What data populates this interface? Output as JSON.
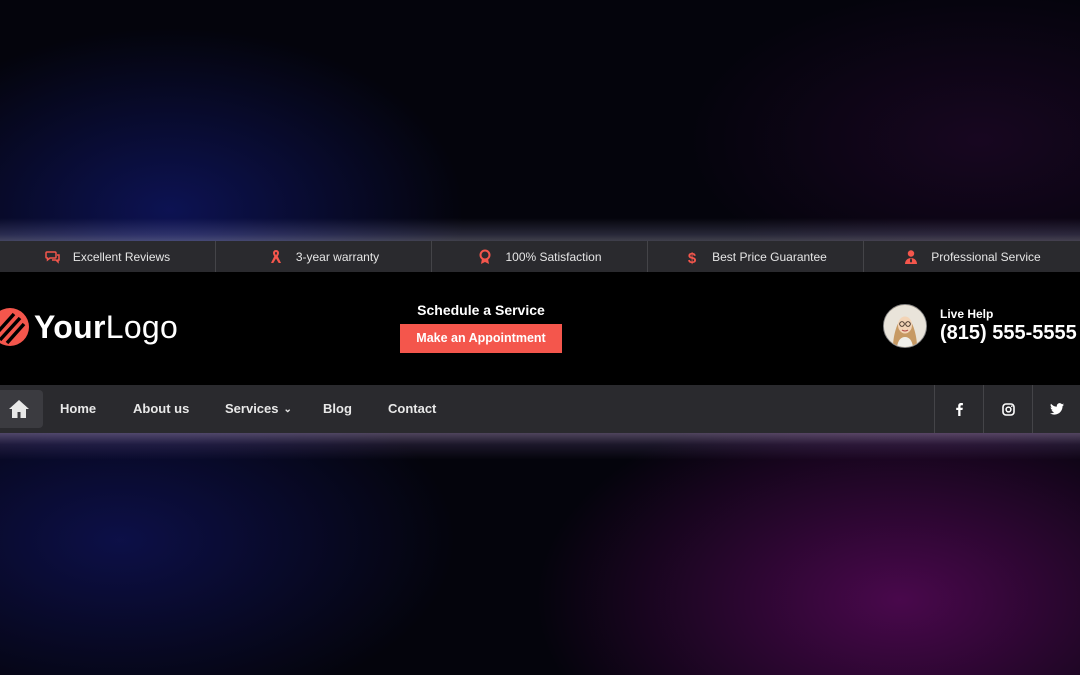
{
  "features": [
    {
      "label": "Excellent Reviews",
      "icon": "chat-bubbles-icon"
    },
    {
      "label": "3-year warranty",
      "icon": "ribbon-icon"
    },
    {
      "label": "100% Satisfaction",
      "icon": "award-badge-icon"
    },
    {
      "label": "Best Price Guarantee",
      "icon": "dollar-icon"
    },
    {
      "label": "Professional Service",
      "icon": "user-tie-icon"
    }
  ],
  "logo": {
    "bold": "Your",
    "regular": "Logo"
  },
  "schedule": {
    "title": "Schedule a Service",
    "button_label": "Make an Appointment"
  },
  "help": {
    "label": "Live Help",
    "phone": "(815) 555-5555"
  },
  "nav": {
    "home_icon": "home-icon",
    "items": [
      {
        "label": "Home"
      },
      {
        "label": "About us"
      },
      {
        "label": "Services",
        "has_dropdown": true
      },
      {
        "label": "Blog"
      },
      {
        "label": "Contact"
      }
    ]
  },
  "socials": [
    "facebook-icon",
    "instagram-icon",
    "twitter-icon"
  ],
  "colors": {
    "accent": "#f4564c",
    "bar_bg": "#2a2a2e",
    "main_bg": "#000000"
  }
}
